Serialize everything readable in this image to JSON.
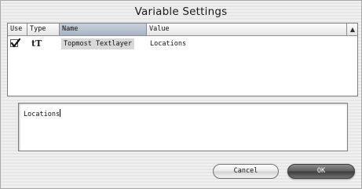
{
  "window": {
    "title": "Variable Settings"
  },
  "table": {
    "columns": [
      {
        "label": "Use"
      },
      {
        "label": "Type"
      },
      {
        "label": "Name"
      },
      {
        "label": "Value"
      }
    ],
    "sort_indicator": "▲",
    "rows": [
      {
        "use_checked": true,
        "type_icon": "text-layer-icon",
        "type_glyph": "tT",
        "name": "Topmost Textlayer",
        "value": "Locations"
      }
    ]
  },
  "editor": {
    "value": "Locations"
  },
  "buttons": {
    "cancel_label": "Cancel",
    "ok_label": "OK"
  },
  "colors": {
    "ok_button": "#4a4a4a",
    "header_sorted": "#b4bfce"
  }
}
